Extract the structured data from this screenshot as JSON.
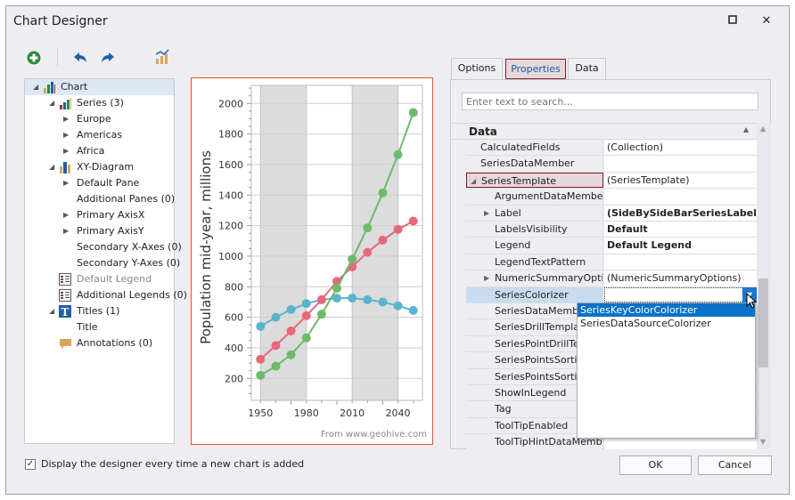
{
  "window": {
    "title": "Chart Designer",
    "maximize_icon": "maximize-icon",
    "close_icon": "close-icon"
  },
  "toolbar": {
    "add_icon": "plus-circle-icon",
    "undo_icon": "undo-icon",
    "redo_icon": "redo-icon",
    "wizard_icon": "chart-wizard-icon"
  },
  "tree": [
    {
      "label": "Chart",
      "level": 0,
      "expander": "expanded",
      "icon": "chart-icon",
      "selected": true
    },
    {
      "label": "Series (3)",
      "level": 1,
      "expander": "expanded",
      "icon": "series-icon"
    },
    {
      "label": "Europe",
      "level": 2,
      "expander": "collapsed"
    },
    {
      "label": "Americas",
      "level": 2,
      "expander": "collapsed"
    },
    {
      "label": "Africa",
      "level": 2,
      "expander": "collapsed"
    },
    {
      "label": "XY-Diagram",
      "level": 1,
      "expander": "expanded",
      "icon": "diagram-icon"
    },
    {
      "label": "Default Pane",
      "level": 2,
      "expander": "collapsed"
    },
    {
      "label": "Additional Panes (0)",
      "level": 2
    },
    {
      "label": "Primary AxisX",
      "level": 2,
      "expander": "collapsed"
    },
    {
      "label": "Primary AxisY",
      "level": 2,
      "expander": "collapsed"
    },
    {
      "label": "Secondary X-Axes (0)",
      "level": 2
    },
    {
      "label": "Secondary Y-Axes (0)",
      "level": 2
    },
    {
      "label": "Default Legend",
      "level": 1,
      "icon": "legend-icon",
      "disabled": true
    },
    {
      "label": "Additional Legends (0)",
      "level": 1,
      "icon": "legend-icon"
    },
    {
      "label": "Titles (1)",
      "level": 1,
      "expander": "expanded",
      "icon": "title-icon"
    },
    {
      "label": "Title",
      "level": 2
    },
    {
      "label": "Annotations (0)",
      "level": 1,
      "icon": "annotation-icon"
    }
  ],
  "chart_data": {
    "type": "line",
    "x": [
      1950,
      1960,
      1970,
      1980,
      1990,
      2000,
      2010,
      2020,
      2030,
      2040,
      2050
    ],
    "series": [
      {
        "color": "#5BB4CF",
        "values": [
          540,
          600,
          650,
          690,
          715,
          725,
          725,
          715,
          700,
          675,
          645
        ]
      },
      {
        "color": "#E8687B",
        "values": [
          325,
          415,
          510,
          610,
          715,
          835,
          930,
          1025,
          1105,
          1175,
          1230
        ]
      },
      {
        "color": "#6CBB6B",
        "values": [
          220,
          280,
          355,
          465,
          620,
          790,
          980,
          1185,
          1415,
          1665,
          1940
        ]
      }
    ],
    "ylabel": "Population mid-year, millions",
    "xticks": [
      1950,
      1980,
      2010,
      2040
    ],
    "yticks": [
      200,
      400,
      600,
      800,
      1000,
      1200,
      1400,
      1600,
      1800,
      2000
    ],
    "xlim": [
      1944,
      2056
    ],
    "ylim": [
      56,
      2118
    ],
    "shaded_ranges": [
      [
        1950,
        1980
      ],
      [
        2010,
        2040
      ]
    ],
    "grid": true,
    "annotation": "From www.geohive.com"
  },
  "tabs": [
    {
      "label": "Options"
    },
    {
      "label": "Properties",
      "active": true
    },
    {
      "label": "Data"
    }
  ],
  "properties": {
    "search_placeholder": "Enter text to search...",
    "category": "Data",
    "rows": [
      {
        "name": "CalculatedFields",
        "value": "(Collection)",
        "indent": 0
      },
      {
        "name": "SeriesDataMember",
        "value": "",
        "indent": 0
      },
      {
        "name": "SeriesTemplate",
        "value": "(SeriesTemplate)",
        "indent": 0,
        "expander": "expanded",
        "highlight": true
      },
      {
        "name": "ArgumentDataMember",
        "value": "",
        "indent": 1
      },
      {
        "name": "Label",
        "value": "(SideBySideBarSeriesLabel)",
        "indent": 1,
        "expander": "collapsed",
        "bold": true
      },
      {
        "name": "LabelsVisibility",
        "value": "Default",
        "indent": 1,
        "bold": true
      },
      {
        "name": "Legend",
        "value": "Default Legend",
        "indent": 1,
        "bold": true
      },
      {
        "name": "LegendTextPattern",
        "value": "",
        "indent": 1
      },
      {
        "name": "NumericSummaryOptions",
        "value": "(NumericSummaryOptions)",
        "indent": 1,
        "expander": "collapsed"
      },
      {
        "name": "SeriesColorizer",
        "value": "",
        "indent": 1,
        "selected": true
      },
      {
        "name": "SeriesDataMember",
        "value": "",
        "indent": 1
      },
      {
        "name": "SeriesDrillTemplate",
        "value": "",
        "indent": 1
      },
      {
        "name": "SeriesPointDrillTemplate",
        "value": "",
        "indent": 1
      },
      {
        "name": "SeriesPointsSorting",
        "value": "",
        "indent": 1
      },
      {
        "name": "SeriesPointsSortingKey",
        "value": "",
        "indent": 1
      },
      {
        "name": "ShowInLegend",
        "value": "",
        "indent": 1
      },
      {
        "name": "Tag",
        "value": "",
        "indent": 1
      },
      {
        "name": "ToolTipEnabled",
        "value": "",
        "indent": 1
      },
      {
        "name": "ToolTipHintDataMember",
        "value": "",
        "indent": 1
      }
    ],
    "dropdown_options": [
      "SeriesKeyColorColorizer",
      "SeriesDataSourceColorizer"
    ],
    "dropdown_selected": 0
  },
  "footer": {
    "checkbox_label": "Display the designer every time a new chart is added",
    "checkbox_checked": true,
    "ok": "OK",
    "cancel": "Cancel"
  }
}
